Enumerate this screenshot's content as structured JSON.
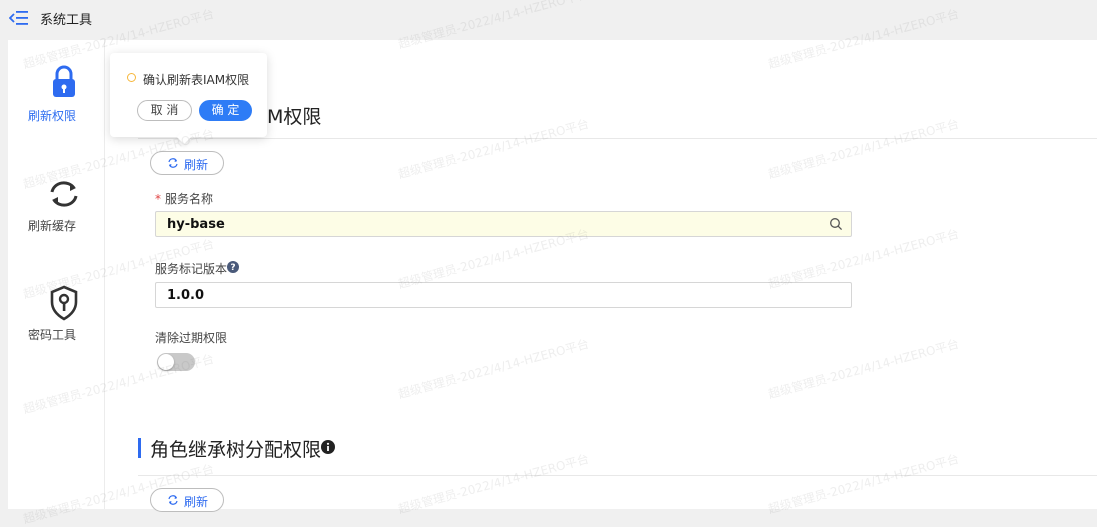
{
  "topbar": {
    "title": "系统工具"
  },
  "sidebar": {
    "items": [
      {
        "label": "刷新权限"
      },
      {
        "label": "刷新缓存"
      },
      {
        "label": "密码工具"
      }
    ]
  },
  "section1": {
    "title_visible": "M权限",
    "refresh_label": "刷新",
    "service_label": "服务名称",
    "service_value": "hy-base",
    "version_label": "服务标记版本",
    "version_value": "1.0.0",
    "clear_label": "清除过期权限",
    "clear_enabled": false
  },
  "section2": {
    "title": "角色继承树分配权限",
    "refresh_label": "刷新"
  },
  "popconfirm": {
    "message": "确认刷新表IAM权限",
    "cancel_label": "取 消",
    "ok_label": "确 定"
  },
  "watermark": "超级管理员-2022/4/14-HZERO平台",
  "colors": {
    "accent": "#2e6bf0",
    "warning": "#f6b73c",
    "required": "#e04242"
  }
}
